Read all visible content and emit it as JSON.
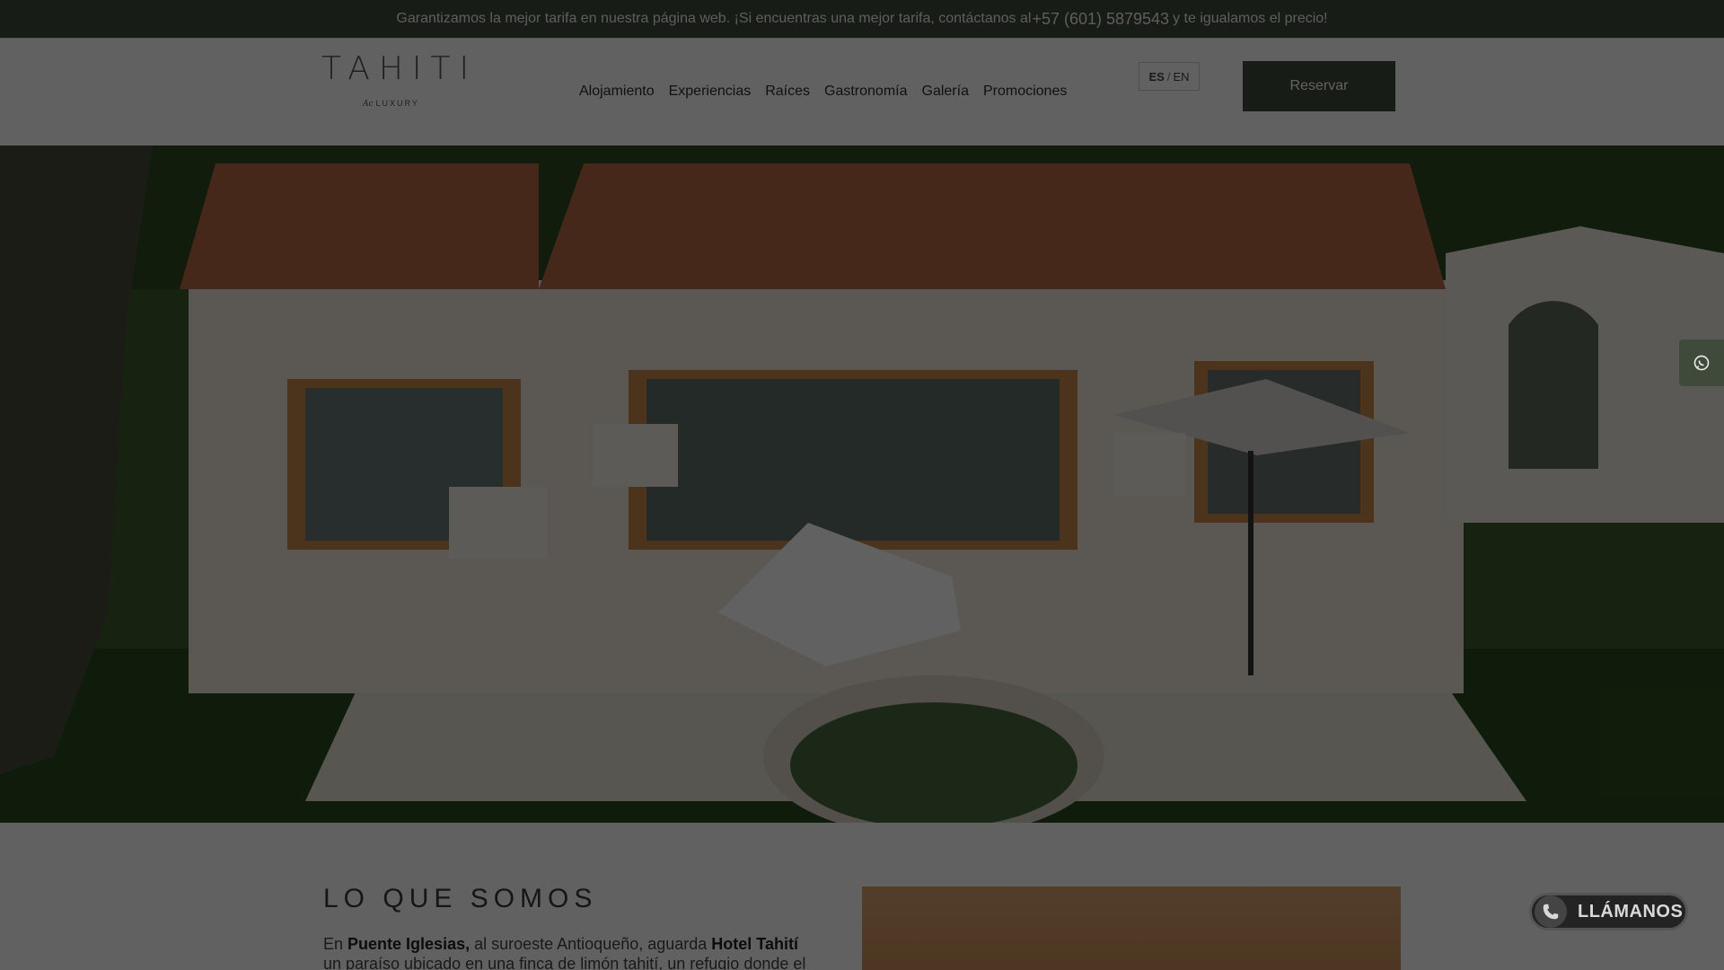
{
  "topbar": {
    "text_before": "Garantizamos la mejor tarifa en nuestra página web. ¡Si encuentras una mejor tarifa, contáctanos al",
    "phone": "+57 (601) 5879543",
    "text_after": "y te igualamos el precio!"
  },
  "logo": {
    "word": "TAHITI",
    "sub_script": "Ac",
    "sub_word": "LUXURY"
  },
  "nav": {
    "items": [
      "Alojamiento",
      "Experiencias",
      "Raíces",
      "Gastronomía",
      "Galería",
      "Promociones"
    ]
  },
  "lang": {
    "active": "ES",
    "separator": "/",
    "other": "EN"
  },
  "reserve_label": "Reservar",
  "about": {
    "title": "LO QUE SOMOS",
    "text_1": "En ",
    "bold_1": "Puente Iglesias,",
    "text_2": " al suroeste Antioqueño, aguarda ",
    "bold_2": "Hotel Tahití",
    "text_3": " un paraíso ubicado en una finca de limón tahití, un refugio donde el"
  },
  "call_button_label": "LLÁMANOS",
  "icons": {
    "whatsapp": "whatsapp-icon",
    "phone": "phone-icon"
  },
  "colors": {
    "brand_dark_green": "#3f4a3a"
  }
}
